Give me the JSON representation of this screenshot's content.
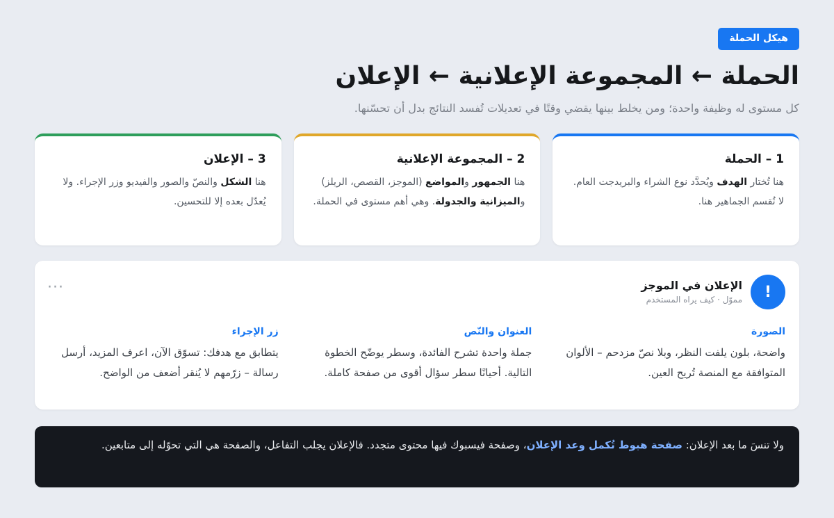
{
  "header": {
    "badge": "هيكل الحملة",
    "title": "الحملة ← المجموعة الإعلانية ← الإعلان",
    "subtitle": "كل مستوى له وظيفة واحدة؛ ومن يخلط بينها يقضي وقتًا في تعديلات تُفسد النتائج بدل أن تحسّنها."
  },
  "levels": [
    {
      "title": "1 – الحملة",
      "t1": "هنا تُختار ",
      "b1": "الهدف",
      "t2": " ويُحدَّد نوع الشراء والبريدجت العام. لا تُقسم الجماهير هنا.",
      "b2": "",
      "t3": "",
      "b3": "",
      "t4": "",
      "accent": "#1877f2"
    },
    {
      "title": "2 – المجموعة الإعلانية",
      "t1": "هنا ",
      "b1": "الجمهور",
      "t2": " و",
      "b2": "المواضع",
      "t3": " (الموجز، القصص، الريلز) و",
      "b3": "الميزانية والجدولة",
      "t4": ". وهي أهم مستوى في الحملة.",
      "accent": "#e0a72a"
    },
    {
      "title": "3 – الإعلان",
      "t1": "هنا ",
      "b1": "الشكل",
      "t2": " والنصّ والصور والفيديو وزر الإجراء. ولا يُعدّل بعده إلا للتحسين.",
      "b2": "",
      "t3": "",
      "b3": "",
      "t4": "",
      "accent": "#2e9e5b"
    }
  ],
  "ad": {
    "icon_text": "!",
    "name": "الإعلان في الموجز",
    "meta": "مموّل · كيف يراه المستخدم",
    "more_icon": "···",
    "columns": [
      {
        "heading": "الصورة",
        "text": "واضحة، بلون يلفت النظر، وبلا نصّ مزدحم – الألوان المتوافقة مع المنصة تُريح العين."
      },
      {
        "heading": "العنوان والنّص",
        "text": "جملة واحدة تشرح الفائدة، وسطر يوضّح الخطوة التالية. أحيانًا سطر سؤال أقوى من صفحة كاملة."
      },
      {
        "heading": "زر الإجراء",
        "text": "يتطابق مع هدفك: تسوّق الآن، اعرف المزيد، أرسل رسالة – زرّمهم لا يُنقر أضعف من الواضح."
      }
    ]
  },
  "note": {
    "t1": "ولا تنسَ ما بعد الإعلان: ",
    "hl": "صفحة هبوط تُكمل وعد الإعلان",
    "t2": "، وصفحة فيسبوك فيها محتوى متجدد. فالإعلان يجلب التفاعل، والصفحة هي التي تحوّله إلى متابعين."
  },
  "colors": {
    "primary": "#1877f2",
    "level2_accent": "#e0a72a",
    "level3_accent": "#2e9e5b",
    "note_bg": "#15181e"
  }
}
